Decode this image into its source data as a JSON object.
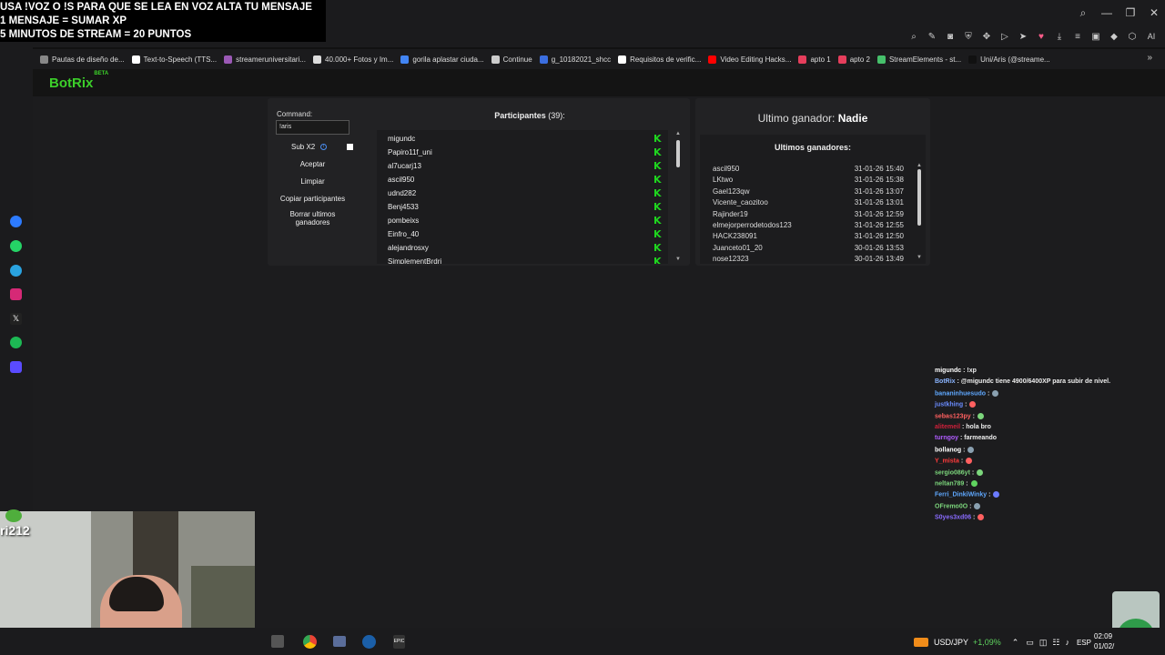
{
  "overlay": {
    "line1": "USA !VOZ O !S PARA QUE SE LEA EN VOZ ALTA TU MENSAJE",
    "line2": "1 MENSAJE = SUMAR XP",
    "line3": "5 MINUTOS DE STREAM = 20 PUNTOS"
  },
  "toolbar": {
    "ai_label": "AI"
  },
  "bookmarks": [
    "Pautas de diseño de...",
    "Text-to-Speech (TTS...",
    "streameruniversitari...",
    "40.000+ Fotos y Im...",
    "gorila aplastar ciuda...",
    "Continue",
    "g_10182021_shcc",
    "Requisitos de verific...",
    "Video Editing Hacks...",
    "apto 1",
    "apto 2",
    "StreamElements - st...",
    "Uni/Aris (@streame..."
  ],
  "app": {
    "logo": "BotRix",
    "badge": "BETA"
  },
  "left_panel": {
    "command_label": "Command:",
    "command_value": "!aris",
    "sub_label": "Sub X2",
    "accept": "Aceptar",
    "clear": "Limpiar",
    "copy": "Copiar participantes",
    "delete": "Borrar ultimos ganadores"
  },
  "participants": {
    "title": "Participantes",
    "count": "(39):",
    "names": [
      "migundc",
      "Papiro11f_uni",
      "al7ucarj13",
      "ascil950",
      "udnd282",
      "Benj4533",
      "pombeixs",
      "Einfro_40",
      "alejandrosxy",
      "SimplementBrdri"
    ]
  },
  "winners": {
    "last_label": "Ultimo ganador:",
    "last_value": "Nadie",
    "title": "Ultimos ganadores:",
    "rows": [
      {
        "name": "ascil950",
        "date": "31-01-26 15:40"
      },
      {
        "name": "LKtwo",
        "date": "31-01-26 15:38"
      },
      {
        "name": "Gael123qw",
        "date": "31-01-26 13:07"
      },
      {
        "name": "Vicente_caozitoo",
        "date": "31-01-26 13:01"
      },
      {
        "name": "Rajinder19",
        "date": "31-01-26 12:59"
      },
      {
        "name": "elmejorperrodetodos123",
        "date": "31-01-26 12:55"
      },
      {
        "name": "HACK238091",
        "date": "31-01-26 12:50"
      },
      {
        "name": "Juanceto01_20",
        "date": "30-01-26 13:53"
      },
      {
        "name": "nose12323",
        "date": "30-01-26 13:49"
      }
    ]
  },
  "chat": [
    {
      "user": "migundc",
      "color": "#ffffff",
      "msg": ": !xp"
    },
    {
      "user": "BotRix",
      "color": "#8ab4ff",
      "msg": ": @migundc tiene 4900/6400XP para subir de nivel."
    },
    {
      "user": "bananinhuesudo",
      "color": "#5fa8ff",
      "msg": ":"
    },
    {
      "user": "justkhing",
      "color": "#6a8cff",
      "msg": ":"
    },
    {
      "user": "sebas123py",
      "color": "#ff6060",
      "msg": ":"
    },
    {
      "user": "alitemeil",
      "color": "#d0203a",
      "msg": ": hola bro"
    },
    {
      "user": "turngoy",
      "color": "#b05cff",
      "msg": ": farmeando"
    },
    {
      "user": "bollanog",
      "color": "#ffffff",
      "msg": ":"
    },
    {
      "user": "Y_mista",
      "color": "#ff3b3b",
      "msg": ":"
    },
    {
      "user": "sergio086yt",
      "color": "#7cd67c",
      "msg": ":"
    },
    {
      "user": "neltan789",
      "color": "#7cd67c",
      "msg": ":"
    },
    {
      "user": "Ferri_DinkiWinky",
      "color": "#5fa8ff",
      "msg": ":"
    },
    {
      "user": "OFremo0O",
      "color": "#7cd67c",
      "msg": ":"
    },
    {
      "user": "S0yes3xd06",
      "color": "#8a6cff",
      "msg": ":"
    }
  ],
  "webcam": {
    "name": "ri212"
  },
  "taskbar": {
    "ticker": "USD/JPY",
    "change": "+1,09%",
    "lang": "ESP",
    "time": "02:09",
    "date": "01/02/"
  }
}
